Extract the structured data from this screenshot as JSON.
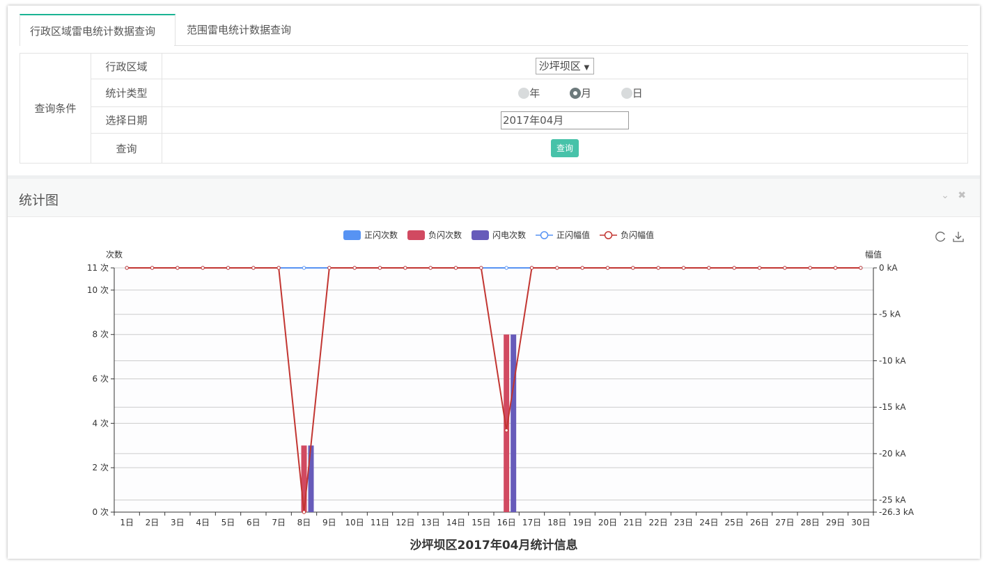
{
  "tabs": [
    {
      "label": "行政区域雷电统计数据查询",
      "active": true
    },
    {
      "label": "范围雷电统计数据查询",
      "active": false
    }
  ],
  "query": {
    "section_label": "查询条件",
    "region_label": "行政区域",
    "region_value": "沙坪坝区",
    "type_label": "统计类型",
    "type_options": [
      "年",
      "月",
      "日"
    ],
    "type_selected": "月",
    "date_label": "选择日期",
    "date_value": "2017年04月",
    "query_label": "查询",
    "query_button": "查询"
  },
  "panel": {
    "title": "统计图"
  },
  "chart_data": {
    "type": "bar",
    "title": "沙坪坝区2017年04月统计信息",
    "left_axis_label": "次数",
    "right_axis_label": "幅值",
    "categories": [
      "1日",
      "2日",
      "3日",
      "4日",
      "5日",
      "6日",
      "7日",
      "8日",
      "9日",
      "10日",
      "11日",
      "12日",
      "13日",
      "14日",
      "15日",
      "16日",
      "17日",
      "18日",
      "19日",
      "20日",
      "21日",
      "22日",
      "23日",
      "24日",
      "25日",
      "26日",
      "27日",
      "28日",
      "29日",
      "30日"
    ],
    "left_ticks": [
      "0 次",
      "2 次",
      "4 次",
      "6 次",
      "8 次",
      "10 次",
      "11 次"
    ],
    "left_tick_values": [
      0,
      2,
      4,
      6,
      8,
      10,
      11
    ],
    "right_ticks": [
      "0 kA",
      "-5 kA",
      "-10 kA",
      "-15 kA",
      "-20 kA",
      "-25 kA",
      "-26.3 kA"
    ],
    "right_tick_values": [
      0,
      -5,
      -10,
      -15,
      -20,
      -25,
      -26.3
    ],
    "ylim_left": [
      0,
      11
    ],
    "ylim_right": [
      -26.3,
      0
    ],
    "colors": {
      "pos_count": "#5793f3",
      "neg_count": "#d14a61",
      "total_count": "#675bba",
      "pos_amp": "#5793f3",
      "neg_amp": "#c23531"
    },
    "series": [
      {
        "name": "正闪次数",
        "kind": "bar",
        "axis": "left",
        "values": [
          0,
          0,
          0,
          0,
          0,
          0,
          0,
          0,
          0,
          0,
          0,
          0,
          0,
          0,
          0,
          0,
          0,
          0,
          0,
          0,
          0,
          0,
          0,
          0,
          0,
          0,
          0,
          0,
          0,
          0
        ]
      },
      {
        "name": "负闪次数",
        "kind": "bar",
        "axis": "left",
        "values": [
          0,
          0,
          0,
          0,
          0,
          0,
          0,
          3,
          0,
          0,
          0,
          0,
          0,
          0,
          0,
          8,
          0,
          0,
          0,
          0,
          0,
          0,
          0,
          0,
          0,
          0,
          0,
          0,
          0,
          0
        ]
      },
      {
        "name": "闪电次数",
        "kind": "bar",
        "axis": "left",
        "values": [
          0,
          0,
          0,
          0,
          0,
          0,
          0,
          3,
          0,
          0,
          0,
          0,
          0,
          0,
          0,
          8,
          0,
          0,
          0,
          0,
          0,
          0,
          0,
          0,
          0,
          0,
          0,
          0,
          0,
          0
        ]
      },
      {
        "name": "正闪幅值",
        "kind": "line",
        "axis": "right",
        "values": [
          0,
          0,
          0,
          0,
          0,
          0,
          0,
          0,
          0,
          0,
          0,
          0,
          0,
          0,
          0,
          0,
          0,
          0,
          0,
          0,
          0,
          0,
          0,
          0,
          0,
          0,
          0,
          0,
          0,
          0
        ]
      },
      {
        "name": "负闪幅值",
        "kind": "line",
        "axis": "right",
        "values": [
          0,
          0,
          0,
          0,
          0,
          0,
          0,
          -26.3,
          0,
          0,
          0,
          0,
          0,
          0,
          0,
          -17.5,
          0,
          0,
          0,
          0,
          0,
          0,
          0,
          0,
          0,
          0,
          0,
          0,
          0,
          0
        ]
      }
    ],
    "grid": true,
    "legend": "top-center"
  }
}
